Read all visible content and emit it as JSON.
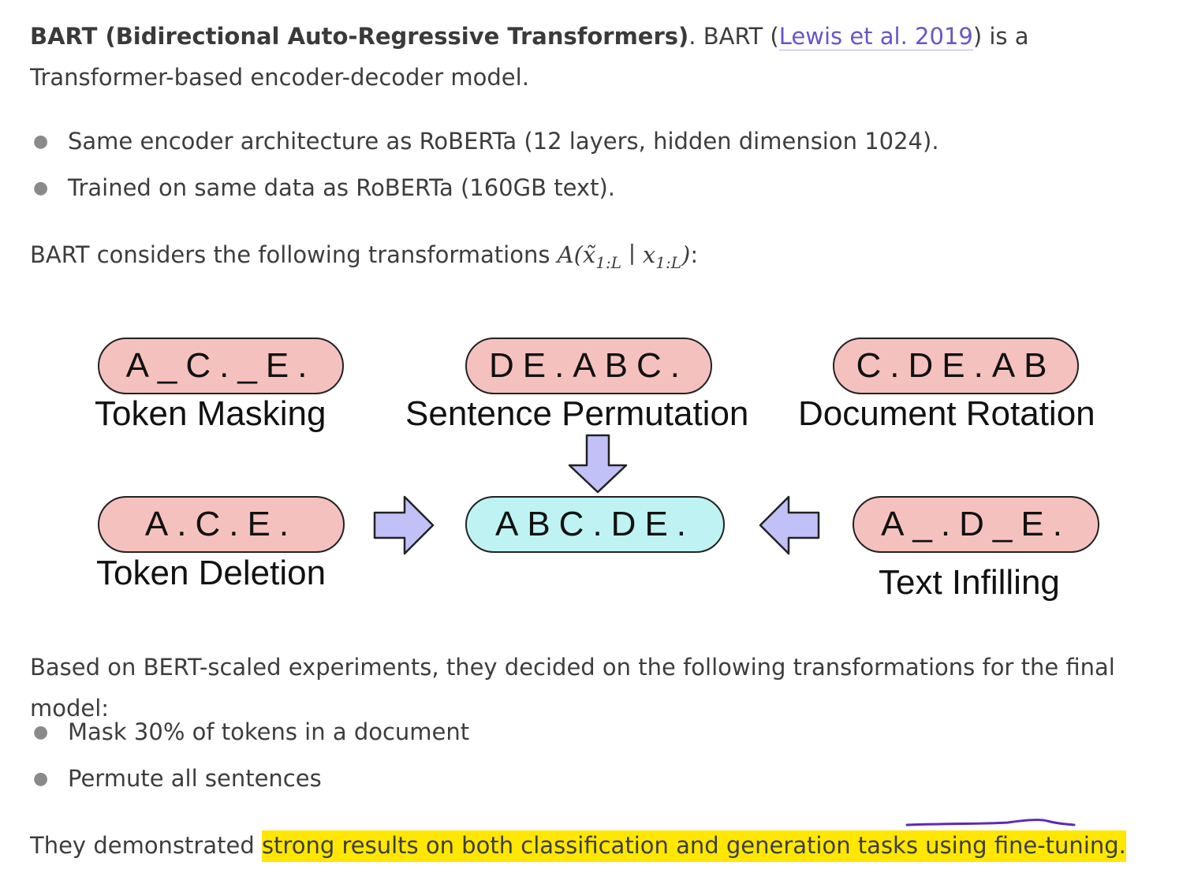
{
  "intro": {
    "bold_title": "BART (Bidirectional Auto-Regressive Transformers)",
    "sentence_start": ". BART (",
    "citation": "Lewis et al. 2019",
    "sentence_end": ") is a Transformer-based encoder-decoder model."
  },
  "bullets_1": [
    "Same encoder architecture as RoBERTa (12 layers, hidden dimension 1024).",
    "Trained on same data as RoBERTa (160GB text)."
  ],
  "transformations_intro": {
    "text": "BART considers the following transformations ",
    "formula_main": "A(x̃",
    "formula_sub1": "1:L",
    "formula_mid": " ∣ x",
    "formula_sub2": "1:L",
    "formula_end": ")",
    "trailing": ":"
  },
  "diagram": {
    "token_masking": {
      "sequence": "A_C._E.",
      "caption": "Token Masking"
    },
    "sentence_permutation": {
      "sequence": "DE.ABC.",
      "caption": "Sentence Permutation"
    },
    "document_rotation": {
      "sequence": "C.DE.AB",
      "caption": "Document Rotation"
    },
    "token_deletion": {
      "sequence": "A.C.E.",
      "caption": "Token Deletion"
    },
    "original": {
      "sequence": "ABC.DE."
    },
    "text_infilling": {
      "sequence": "A_.D_E.",
      "caption": "Text Infilling"
    },
    "colors": {
      "corrupted": "#f5c1bf",
      "original": "#bff2f3",
      "arrow": "#c1c1f7"
    }
  },
  "based_on": "Based on BERT-scaled experiments, they decided on the following transformations for the final model:",
  "bullets_2": [
    "Mask 30% of tokens in a document",
    "Permute all sentences"
  ],
  "closing": {
    "prefix": "They demonstrated ",
    "highlighted": "strong results on both classification and generation tasks using fine-tuning.",
    "highlight_color": "#ffe700",
    "pen_color": "#5b2bb5"
  }
}
